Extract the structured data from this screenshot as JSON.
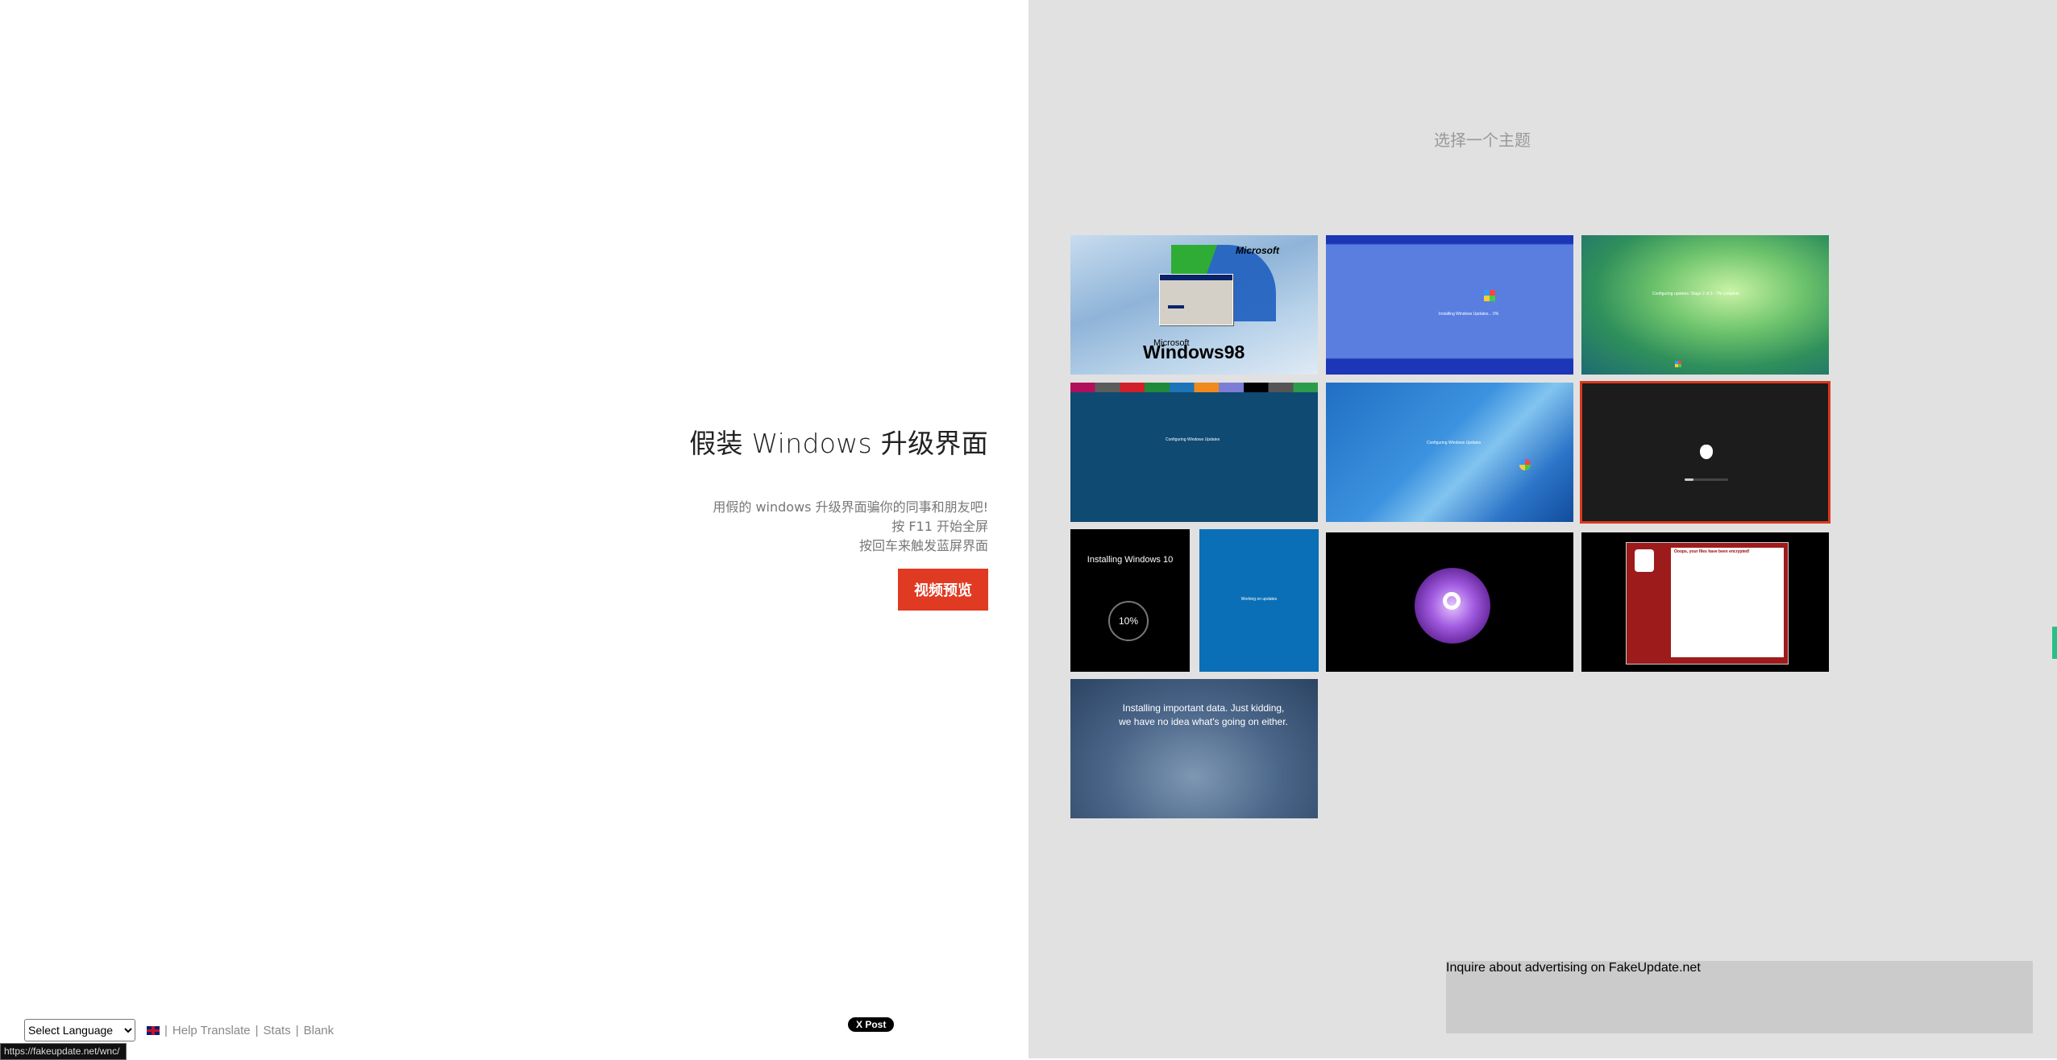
{
  "intro": {
    "title": "假装 Windows 升级界面",
    "lines": [
      "用假的 windows 升级界面骗你的同事和朋友吧!",
      "按 F11 开始全屏",
      "按回车来触发蓝屏界面"
    ],
    "video_button": "视频预览"
  },
  "footer": {
    "language_select": "Select Language",
    "links": [
      "Help Translate",
      "Stats",
      "Blank"
    ],
    "separator": "|",
    "post_button": "X Post",
    "status_url": "https://fakeupdate.net/wnc/"
  },
  "themes": {
    "title": "选择一个主题",
    "items": [
      {
        "name": "win98",
        "text_brand": "Microsoft",
        "text_logo": "Windows98",
        "text_small": "Microsoft"
      },
      {
        "name": "xp",
        "text": "Installing Windows Updates... 0%"
      },
      {
        "name": "vista",
        "text": "Configuring updates: Stage 2 of 3 - 7% complete"
      },
      {
        "name": "win8",
        "text": "Configuring Windows Updates"
      },
      {
        "name": "win7",
        "text": "Configuring Windows Updates"
      },
      {
        "name": "macos",
        "selected": true
      },
      {
        "name": "win10-install",
        "text": "Installing Windows 10",
        "percent": "10%"
      },
      {
        "name": "win10-update",
        "text": "Working on updates"
      },
      {
        "name": "steam"
      },
      {
        "name": "ransomware",
        "text": "Ooops, your files have been encrypted!"
      },
      {
        "name": "joke",
        "text": "Installing important data. Just kidding, we have no idea what's going on either."
      }
    ]
  },
  "ad": {
    "text": "Inquire about advertising on FakeUpdate.net"
  },
  "colors": {
    "accent": "#e03a22",
    "right_bg": "#e1e1e1"
  }
}
